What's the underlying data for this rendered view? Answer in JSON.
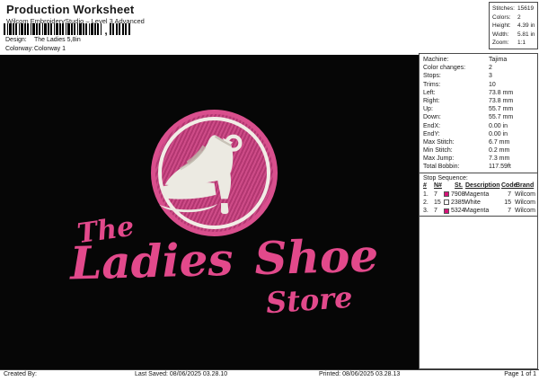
{
  "header": {
    "title": "Production Worksheet",
    "subtitle": "Wilcom EmbroideryStudio – Level 3 Advanced",
    "barcode_comma": ",",
    "design_label": "Design:",
    "design_value": "The Ladies 5,8in",
    "colorway_label": "Colorway:",
    "colorway_value": "Colorway 1"
  },
  "summary": {
    "rows": [
      {
        "label": "Stitches:",
        "value": "15619"
      },
      {
        "label": "Colors:",
        "value": "2"
      },
      {
        "label": "Height:",
        "value": "4.39 in"
      },
      {
        "label": "Width:",
        "value": "5.81 in"
      },
      {
        "label": "Zoom:",
        "value": "1:1"
      }
    ]
  },
  "machine": {
    "rows": [
      {
        "label": "Machine:",
        "value": "Tajima"
      },
      {
        "label": "Color changes:",
        "value": "2"
      },
      {
        "label": "Stops:",
        "value": "3"
      },
      {
        "label": "Trims:",
        "value": "10"
      },
      {
        "label": "Left:",
        "value": "73.8 mm"
      },
      {
        "label": "Right:",
        "value": "73.8 mm"
      },
      {
        "label": "Up:",
        "value": "55.7 mm"
      },
      {
        "label": "Down:",
        "value": "55.7 mm"
      },
      {
        "label": "EndX:",
        "value": "0.00 in"
      },
      {
        "label": "EndY:",
        "value": "0.00 in"
      },
      {
        "label": "Max Stitch:",
        "value": "6.7 mm"
      },
      {
        "label": "Min Stitch:",
        "value": "0.2 mm"
      },
      {
        "label": "Max Jump:",
        "value": "7.3 mm"
      },
      {
        "label": "Total Bobbin:",
        "value": "117.59ft"
      }
    ]
  },
  "stop_sequence": {
    "title": "Stop Sequence:",
    "headers": [
      "#",
      "N#",
      "St.",
      "Description",
      "Code",
      "Brand"
    ],
    "rows": [
      {
        "num": "1.",
        "n": "7",
        "swatch": "#d61178",
        "st": "7908",
        "description": "Magenta",
        "code": "7",
        "brand": "Wilcom"
      },
      {
        "num": "2.",
        "n": "15",
        "swatch": "#ffffff",
        "st": "2385",
        "description": "White",
        "code": "15",
        "brand": "Wilcom"
      },
      {
        "num": "3.",
        "n": "7",
        "swatch": "#d61178",
        "st": "5324",
        "description": "Magenta",
        "code": "7",
        "brand": "Wilcom"
      }
    ]
  },
  "design": {
    "text_the": "The",
    "text_ladies": "Ladies",
    "text_shoe": "Shoe",
    "text_store": "Store",
    "colors": {
      "script_pink": "#e2498b",
      "thread_magenta": "#d94f8d",
      "circle_fill": "#ca3e7f",
      "thread_white": "#efece4",
      "canvas_black": "#060606"
    }
  },
  "footer": {
    "created_by": "Created By:",
    "last_saved": "Last Saved: 08/06/2025 03.28.10",
    "printed": "Printed: 08/06/2025 03.28.13",
    "page": "Page 1 of 1"
  }
}
